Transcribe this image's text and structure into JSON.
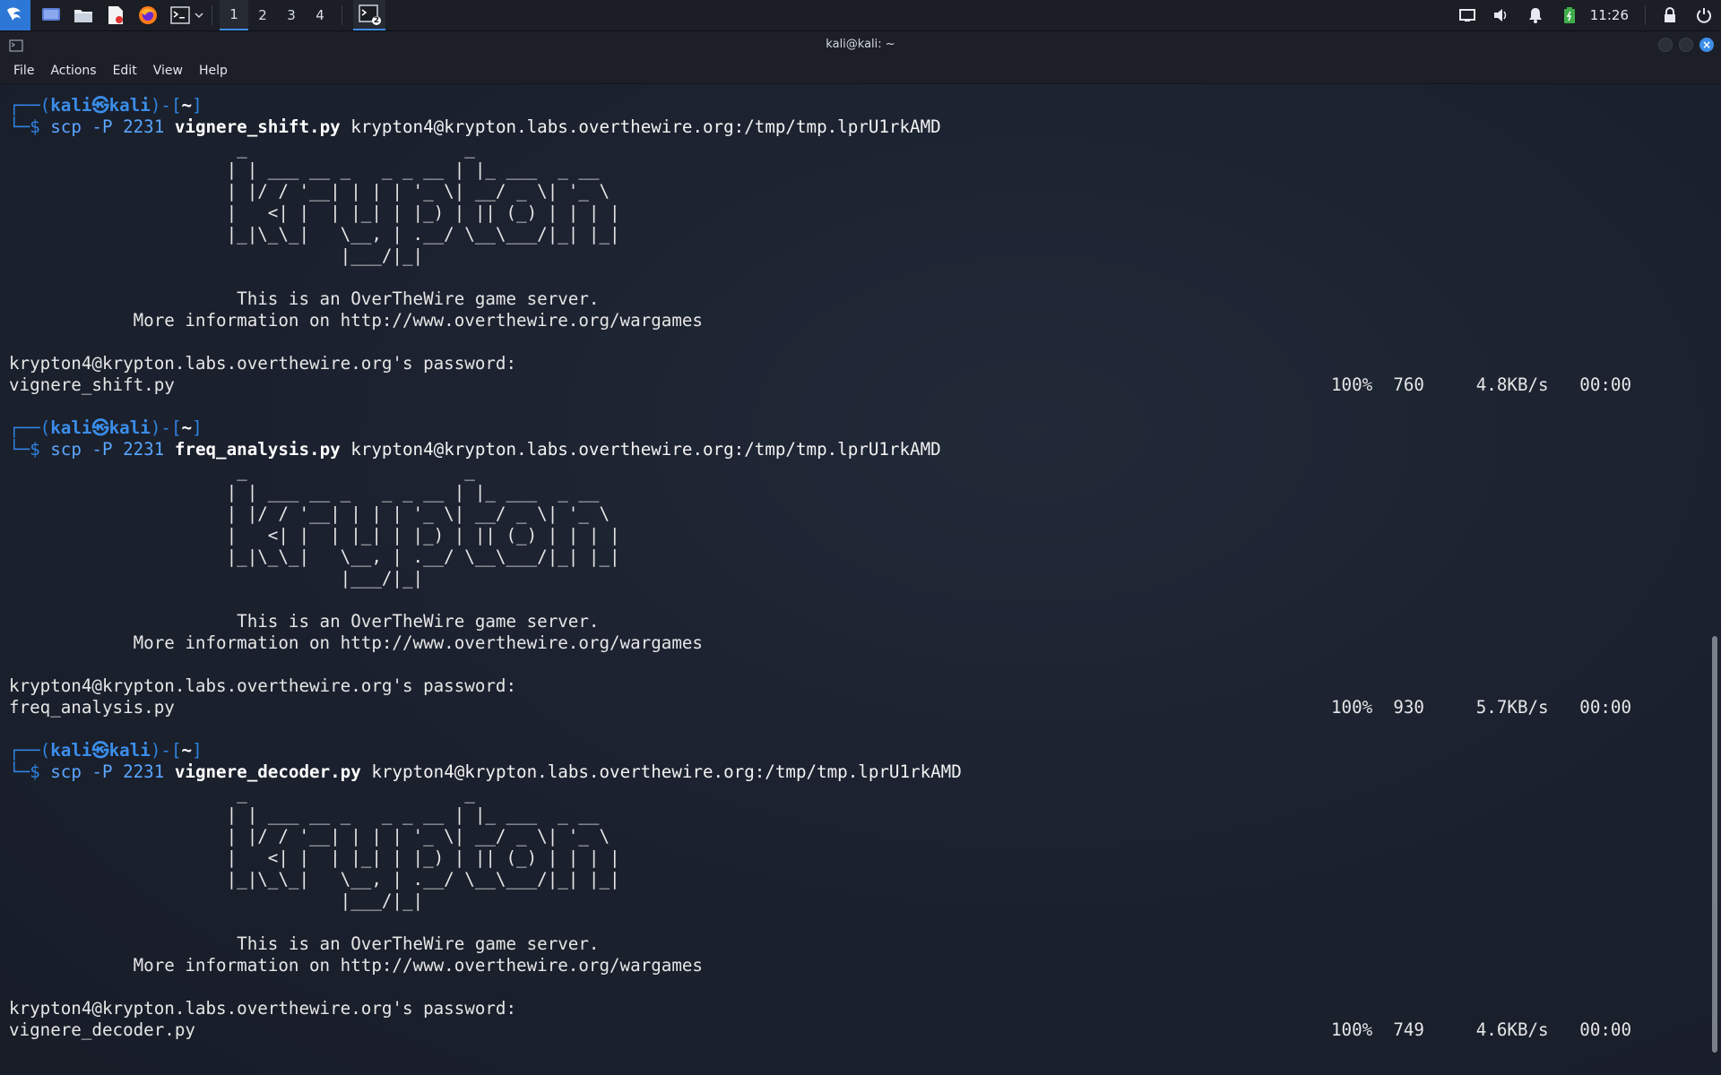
{
  "panel": {
    "workspaces": [
      "1",
      "2",
      "3",
      "4"
    ],
    "active_workspace": "1",
    "task_badge": "2",
    "clock": "11:26",
    "icons": [
      "kali-menu-icon",
      "desktop-icon",
      "file-manager-icon",
      "text-editor-icon",
      "firefox-icon",
      "terminal-icon",
      "chevron-down-icon",
      "display-icon",
      "volume-icon",
      "bell-icon",
      "battery-icon",
      "lock-icon",
      "power-icon"
    ]
  },
  "window": {
    "title": "kali@kali: ~",
    "menu": [
      "File",
      "Actions",
      "Edit",
      "View",
      "Help"
    ]
  },
  "terminal": {
    "prompt_user": "kali",
    "prompt_host": "kali",
    "prompt_dir": "~",
    "prompt_at": "㉿",
    "prompt_top_open": "┌──(",
    "prompt_mid": ")-[",
    "prompt_close": "]",
    "prompt_bottom": "└─$ ",
    "cmd_base": "scp -P 2231 ",
    "banner": [
      "                      _                     _",
      "                     | | ___ __ _   _ _ __ | |_ ___  _ __",
      "                     | |/ / '__| | | | '_ \\| __/ _ \\| '_ \\",
      "                     |   <| |  | |_| | |_) | || (_) | | | |",
      "                     |_|\\_\\_|   \\__, | .__/ \\__\\___/|_| |_|",
      "                                |___/|_|",
      "",
      "                      This is an OverTheWire game server.",
      "            More information on http://www.overthewire.org/wargames",
      ""
    ],
    "password_prompt": "krypton4@krypton.labs.overthewire.org's password:",
    "blocks": [
      {
        "file": "vignere_shift.py",
        "dest": "krypton4@krypton.labs.overthewire.org:/tmp/tmp.lprU1rkAMD",
        "percent": "100%",
        "size": "760",
        "rate": "4.8KB/s",
        "time": "00:00"
      },
      {
        "file": "freq_analysis.py",
        "dest": "krypton4@krypton.labs.overthewire.org:/tmp/tmp.lprU1rkAMD",
        "percent": "100%",
        "size": "930",
        "rate": "5.7KB/s",
        "time": "00:00"
      },
      {
        "file": "vignere_decoder.py",
        "dest": "krypton4@krypton.labs.overthewire.org:/tmp/tmp.lprU1rkAMD",
        "percent": "100%",
        "size": "749",
        "rate": "4.6KB/s",
        "time": "00:00"
      }
    ]
  }
}
